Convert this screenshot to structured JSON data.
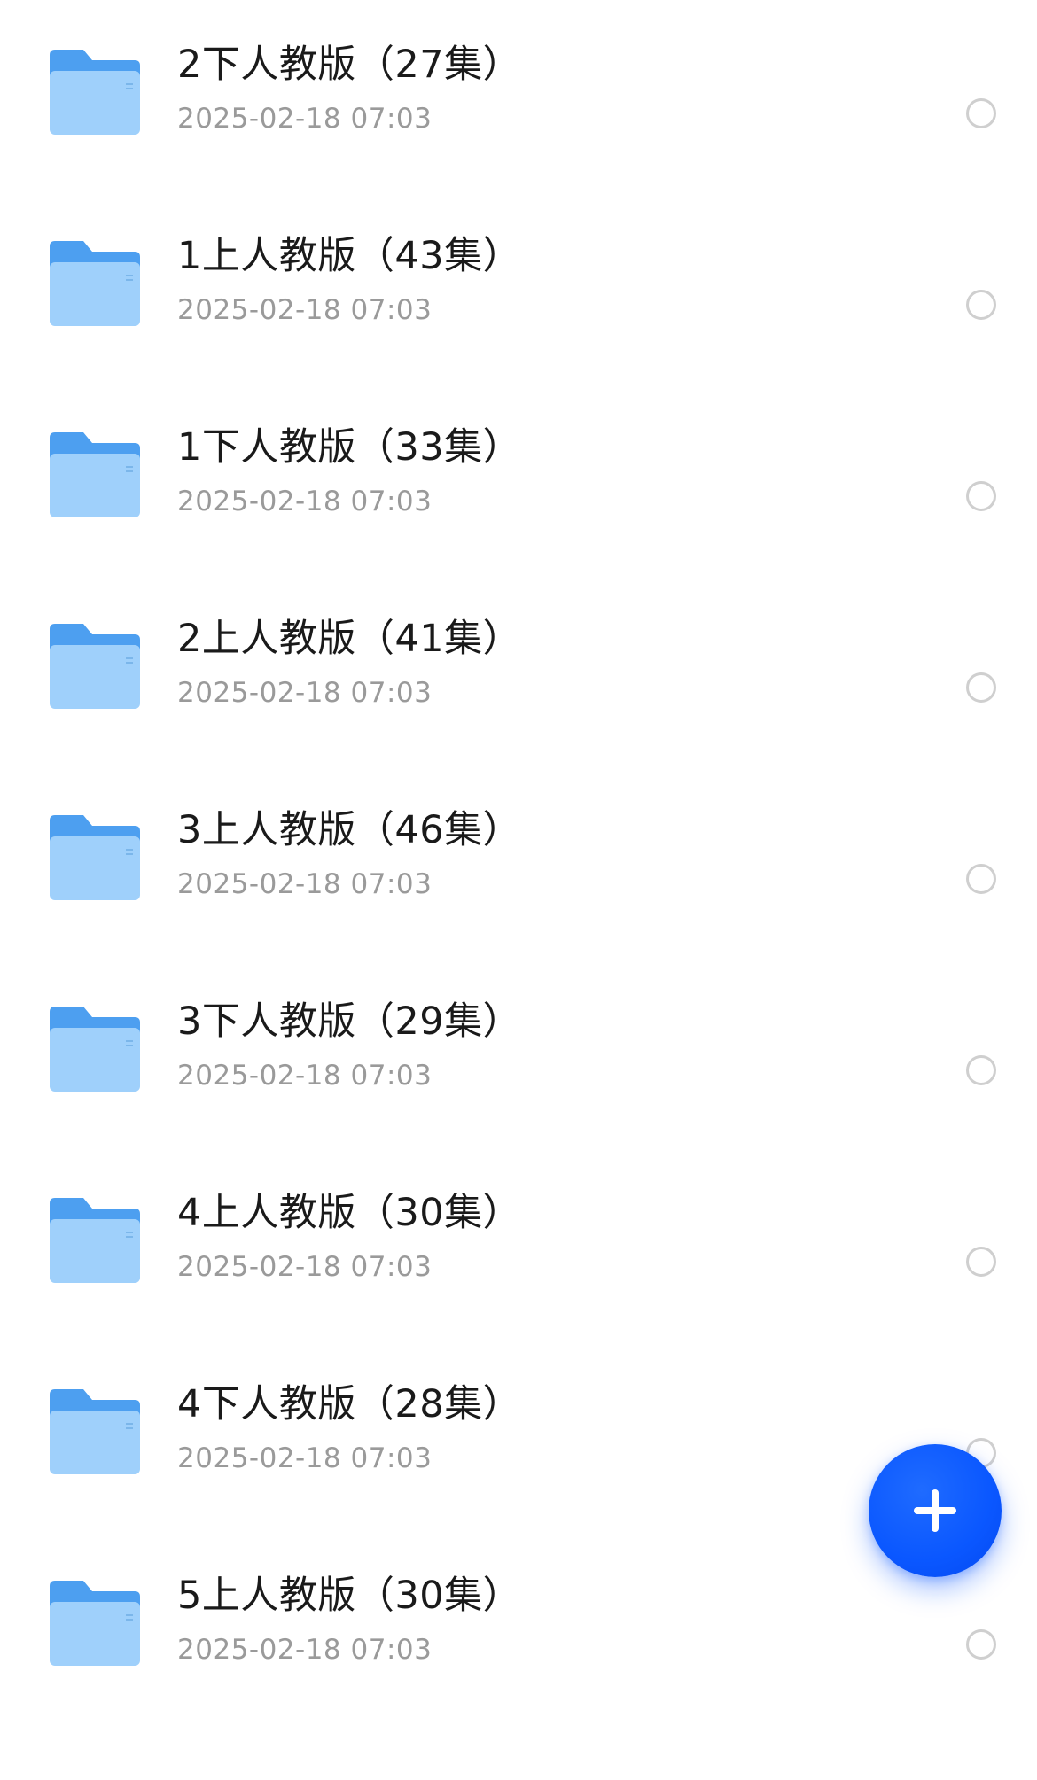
{
  "colors": {
    "accent": "#0a57ff",
    "folder_back": "#5aa9f2",
    "folder_front": "#9fd0fb",
    "title_text": "#1a1a1a",
    "date_text": "#9a9a9a"
  },
  "fab": {
    "icon": "plus-icon"
  },
  "items": [
    {
      "title": "2下人教版（27集）",
      "date": "2025-02-18 07:03",
      "icon": "folder-icon"
    },
    {
      "title": "1上人教版（43集）",
      "date": "2025-02-18 07:03",
      "icon": "folder-icon"
    },
    {
      "title": "1下人教版（33集）",
      "date": "2025-02-18 07:03",
      "icon": "folder-icon"
    },
    {
      "title": "2上人教版（41集）",
      "date": "2025-02-18 07:03",
      "icon": "folder-icon"
    },
    {
      "title": "3上人教版（46集）",
      "date": "2025-02-18 07:03",
      "icon": "folder-icon"
    },
    {
      "title": "3下人教版（29集）",
      "date": "2025-02-18 07:03",
      "icon": "folder-icon"
    },
    {
      "title": "4上人教版（30集）",
      "date": "2025-02-18 07:03",
      "icon": "folder-icon"
    },
    {
      "title": "4下人教版（28集）",
      "date": "2025-02-18 07:03",
      "icon": "folder-icon"
    },
    {
      "title": "5上人教版（30集）",
      "date": "2025-02-18 07:03",
      "icon": "folder-icon"
    }
  ]
}
